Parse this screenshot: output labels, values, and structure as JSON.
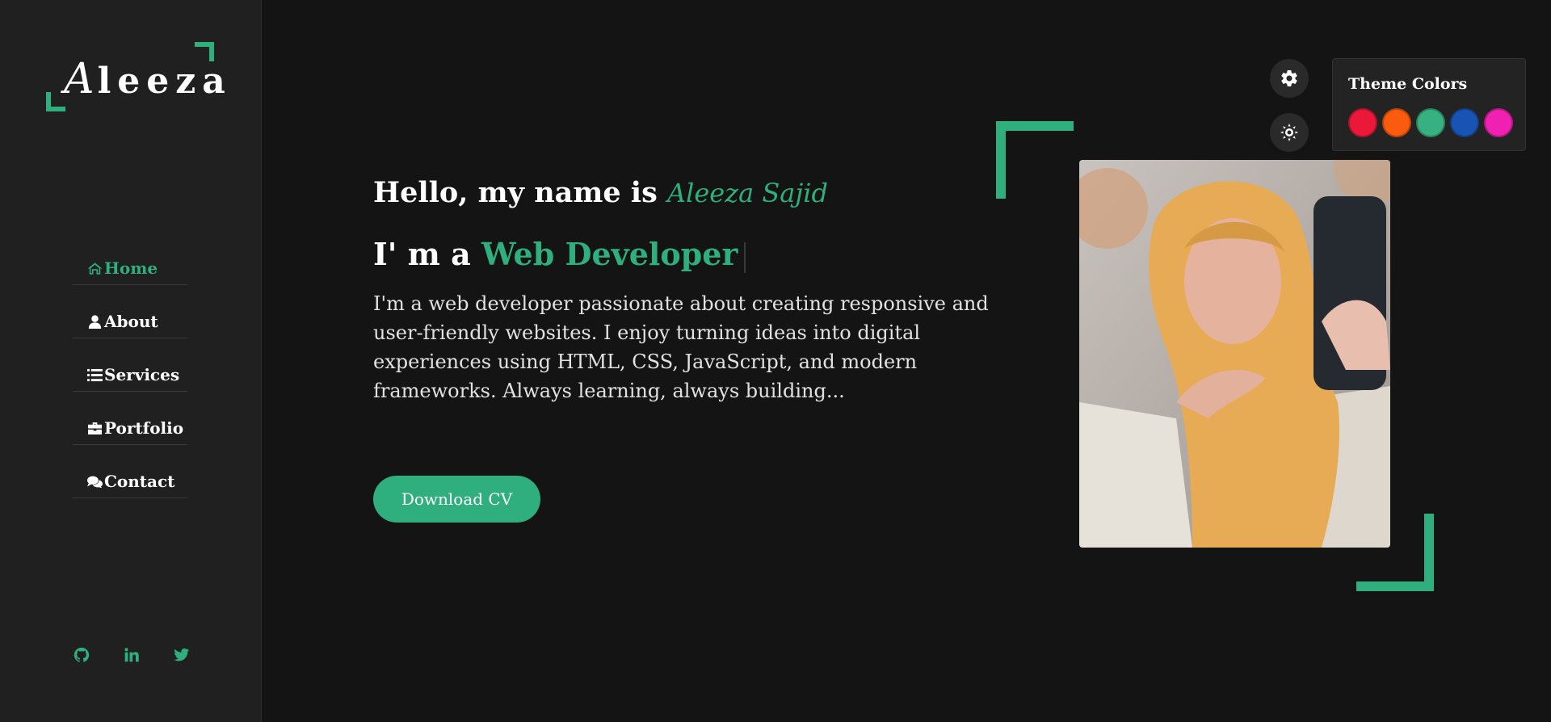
{
  "logo": {
    "first_letter": "A",
    "rest": "leeza"
  },
  "nav": {
    "items": [
      {
        "label": "Home",
        "icon": "home-icon",
        "active": true
      },
      {
        "label": "About",
        "icon": "user-icon",
        "active": false
      },
      {
        "label": "Services",
        "icon": "list-icon",
        "active": false
      },
      {
        "label": "Portfolio",
        "icon": "briefcase-icon",
        "active": false
      },
      {
        "label": "Contact",
        "icon": "comments-icon",
        "active": false
      }
    ]
  },
  "socials": [
    "github-icon",
    "linkedin-icon",
    "twitter-icon"
  ],
  "hero": {
    "greeting": "Hello, my name is",
    "name": "Aleeza Sajid",
    "role_prefix": "I' m a",
    "role": "Web Developer",
    "bio": "I'm a web developer passionate about creating responsive and user-friendly websites. I enjoy turning ideas into digital experiences using HTML, CSS, JavaScript, and modern frameworks. Always learning, always building...",
    "cta": "Download CV"
  },
  "theme": {
    "title": "Theme Colors",
    "swatches": [
      {
        "name": "red",
        "color": "#ec1839"
      },
      {
        "name": "orange",
        "color": "#fa5b0f"
      },
      {
        "name": "green",
        "color": "#37b182"
      },
      {
        "name": "blue",
        "color": "#1854b4"
      },
      {
        "name": "pink",
        "color": "#f021b2"
      }
    ],
    "accent": "#2fae7e"
  }
}
